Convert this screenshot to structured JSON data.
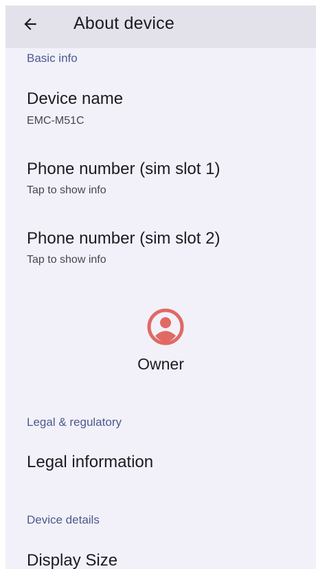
{
  "app_bar": {
    "title": "About device",
    "back_icon": "arrow-left-icon"
  },
  "sections": {
    "basic_info": "Basic info",
    "legal": "Legal & regulatory",
    "device_details": "Device details"
  },
  "items": {
    "device_name": {
      "title": "Device name",
      "summary": "EMC-M51C"
    },
    "phone1": {
      "title": "Phone number (sim slot 1)",
      "summary": "Tap to show info"
    },
    "phone2": {
      "title": "Phone number (sim slot 2)",
      "summary": "Tap to show info"
    },
    "owner": {
      "label": "Owner",
      "icon": "account-circle-icon"
    },
    "legal_info": {
      "title": "Legal information"
    },
    "display_size": {
      "title": "Display Size"
    }
  },
  "colors": {
    "background": "#f2f1f9",
    "app_bar": "#e3e2ea",
    "section_header": "#4a5a8e",
    "owner_icon": "#e06a63"
  }
}
